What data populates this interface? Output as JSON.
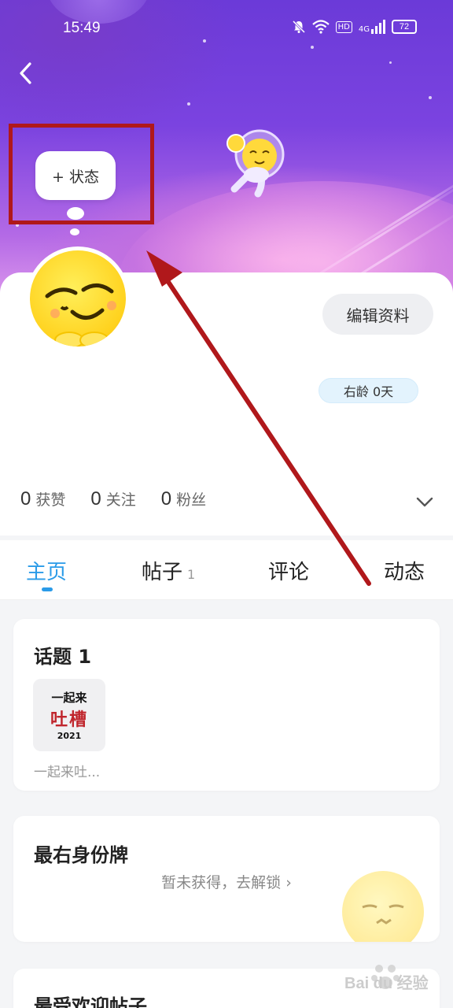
{
  "status_bar": {
    "time": "15:49",
    "network": "4G",
    "hd": "HD",
    "battery": "72"
  },
  "status_bubble": {
    "label": "+ 状态"
  },
  "profile": {
    "edit_button": "编辑资料",
    "age_badge": "右龄 0天",
    "stats": [
      {
        "value": "0",
        "label": "获赞"
      },
      {
        "value": "0",
        "label": "关注"
      },
      {
        "value": "0",
        "label": "粉丝"
      }
    ]
  },
  "tabs": [
    {
      "label": "主页",
      "count": ""
    },
    {
      "label": "帖子",
      "count": "1"
    },
    {
      "label": "评论",
      "count": ""
    },
    {
      "label": "动态",
      "count": ""
    }
  ],
  "topics_card": {
    "title": "话题 1",
    "thumb_line1": "一起来",
    "thumb_line2": "吐槽",
    "thumb_year": "2021",
    "caption": "一起来吐..."
  },
  "identity_card": {
    "title": "最右身份牌",
    "unlock_text": "暂未获得，去解锁 ›"
  },
  "popular_card": {
    "title": "最受欢迎帖子"
  },
  "watermark": {
    "text": "Bai du 经验"
  },
  "colors": {
    "accent": "#2a9be8",
    "annotation_red": "#b0181b"
  }
}
